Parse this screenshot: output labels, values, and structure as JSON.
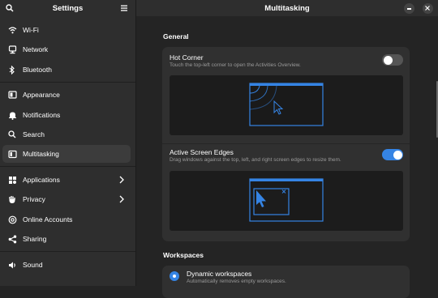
{
  "sidebar": {
    "title": "Settings",
    "items": [
      {
        "label": "Wi-Fi",
        "icon": "wifi-icon"
      },
      {
        "label": "Network",
        "icon": "network-icon"
      },
      {
        "label": "Bluetooth",
        "icon": "bluetooth-icon"
      },
      {
        "label": "Appearance",
        "icon": "appearance-icon"
      },
      {
        "label": "Notifications",
        "icon": "bell-icon"
      },
      {
        "label": "Search",
        "icon": "search-icon"
      },
      {
        "label": "Multitasking",
        "icon": "multitasking-icon",
        "active": true
      },
      {
        "label": "Applications",
        "icon": "apps-icon",
        "has_submenu": true
      },
      {
        "label": "Privacy",
        "icon": "hand-icon",
        "has_submenu": true
      },
      {
        "label": "Online Accounts",
        "icon": "at-icon"
      },
      {
        "label": "Sharing",
        "icon": "share-icon"
      },
      {
        "label": "Sound",
        "icon": "speaker-icon"
      }
    ]
  },
  "main": {
    "title": "Multitasking",
    "general": {
      "heading": "General",
      "hot_corner": {
        "title": "Hot Corner",
        "subtitle": "Touch the top-left corner to open the Activities Overview.",
        "enabled": false
      },
      "active_screen_edges": {
        "title": "Active Screen Edges",
        "subtitle": "Drag windows against the top, left, and right screen edges to resize them.",
        "enabled": true
      }
    },
    "workspaces": {
      "heading": "Workspaces",
      "dynamic": {
        "title": "Dynamic workspaces",
        "subtitle": "Automatically removes empty workspaces.",
        "selected": true
      }
    }
  },
  "colors": {
    "accent": "#3584e4",
    "sidebar_bg": "#2e2e2e",
    "main_bg": "#242424",
    "card_bg": "#303030"
  }
}
